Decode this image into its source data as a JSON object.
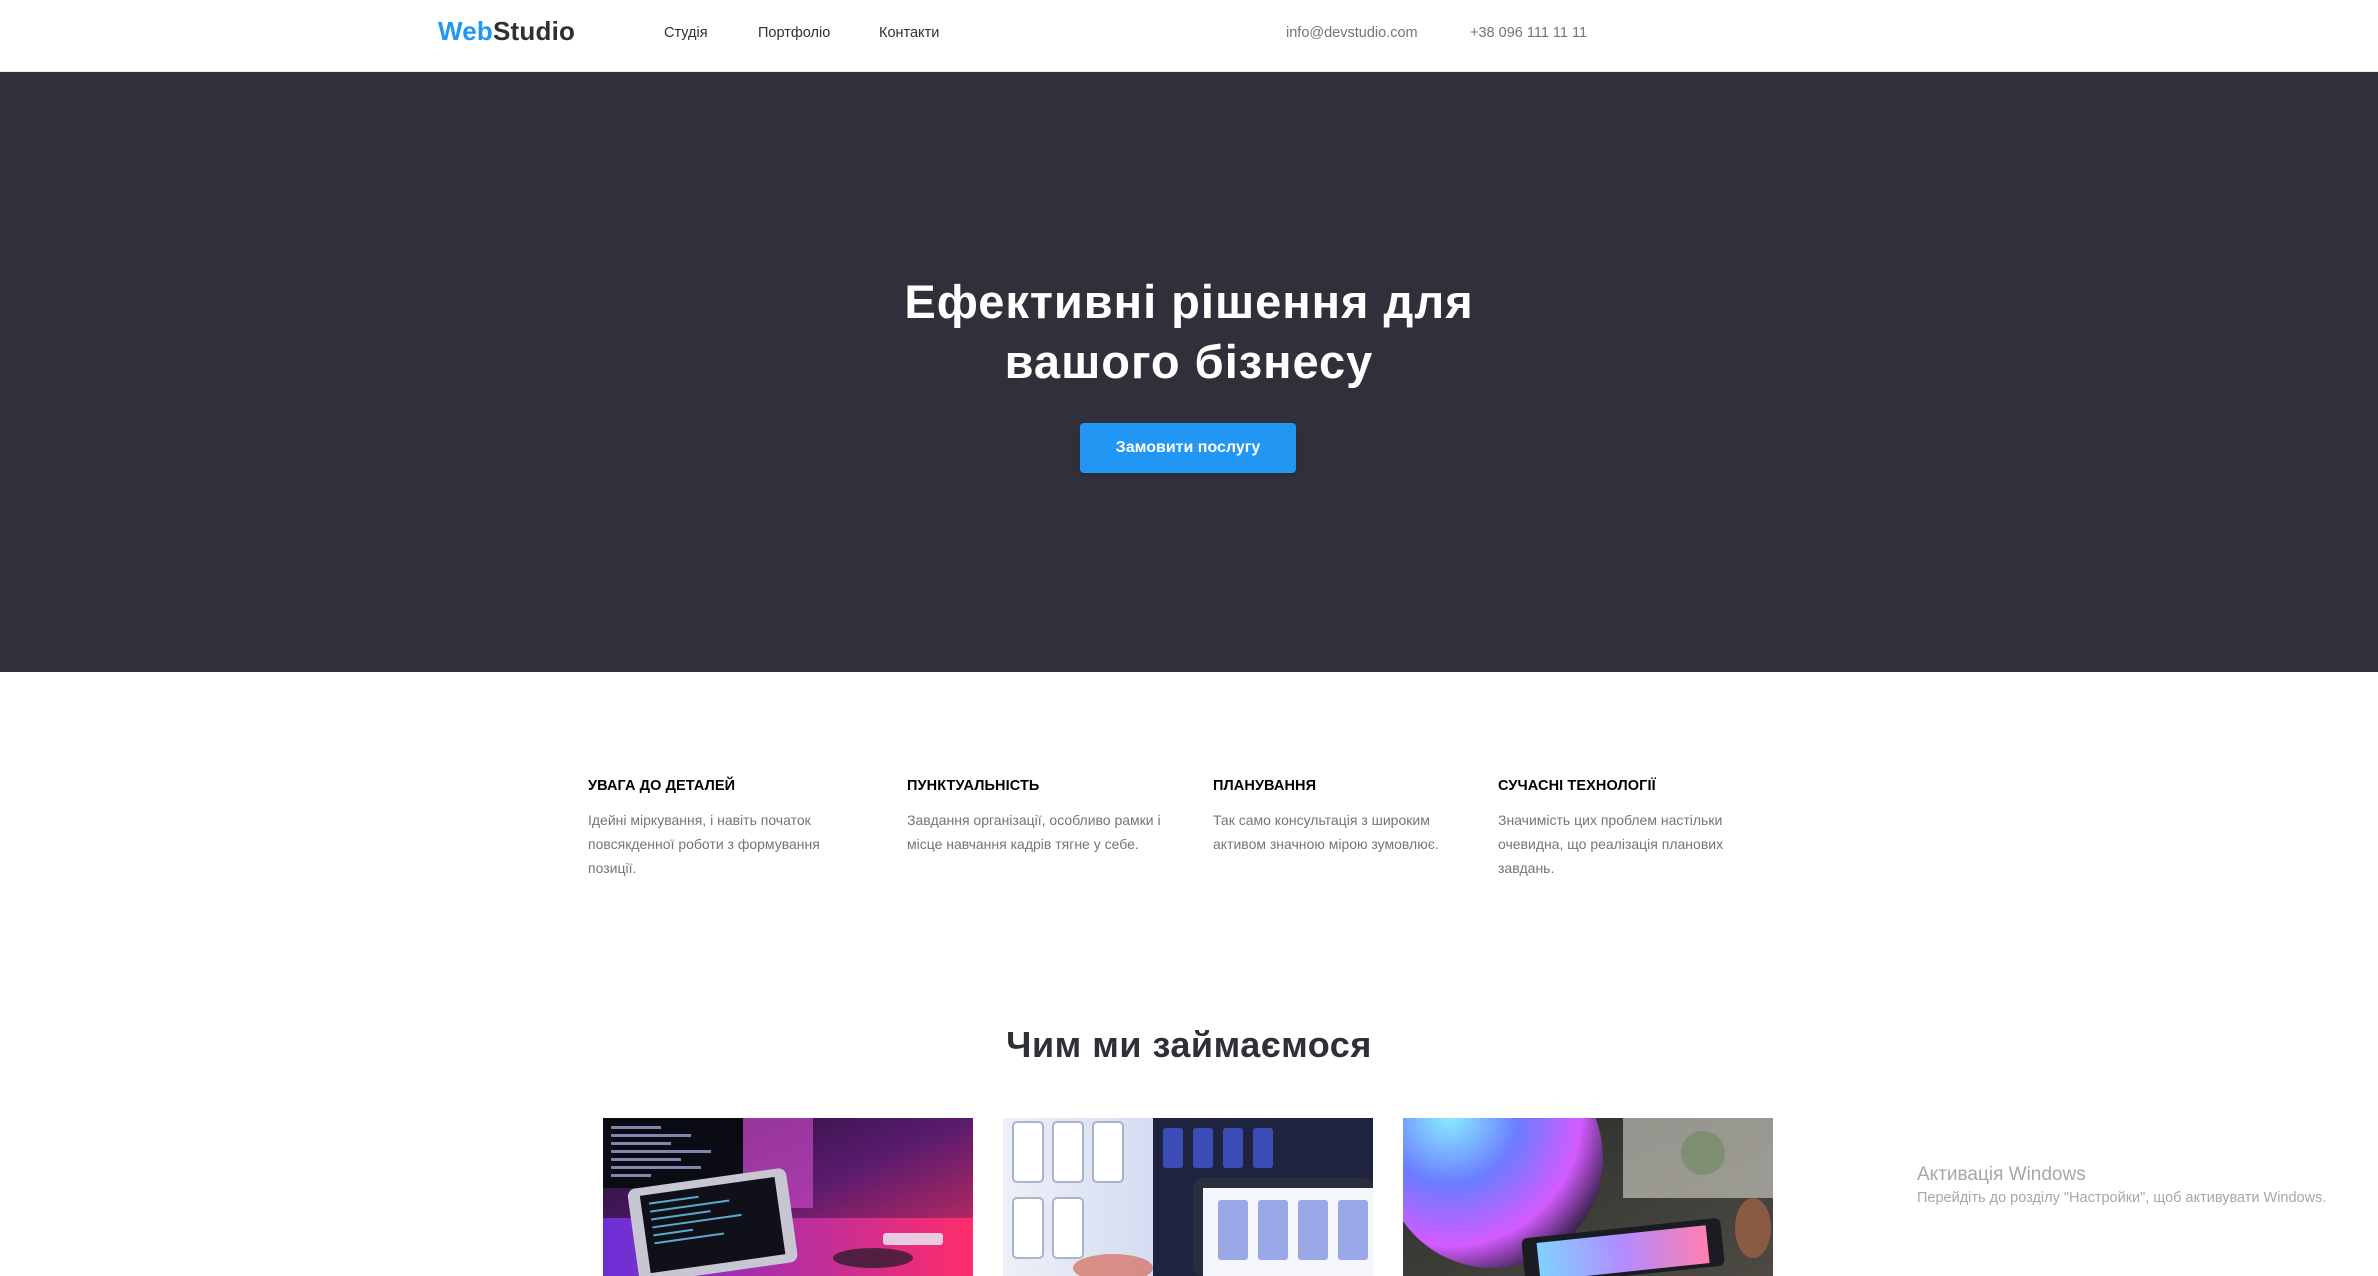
{
  "header": {
    "logo_part1": "Web",
    "logo_part2": "Studio",
    "nav": [
      {
        "label": "Студія"
      },
      {
        "label": "Портфоліо"
      },
      {
        "label": "Контакти"
      }
    ],
    "email": "info@devstudio.com",
    "phone": "+38 096 111 11 11"
  },
  "hero": {
    "title_line1": "Ефективні рішення для",
    "title_line2": "вашого бізнесу",
    "button_label": "Замовити послугу"
  },
  "features": [
    {
      "title": "Увага до деталей",
      "text_lines": [
        "Ідейні міркування, і навіть початок",
        "повсякденної роботи з формування",
        "позиції."
      ]
    },
    {
      "title": "Пунктуальність",
      "text_lines": [
        "Завдання організації, особливо рамки і",
        "місце навчання кадрів тягне у себе."
      ]
    },
    {
      "title": "Планування",
      "text_lines": [
        "Так само консультація з широким",
        "активом значною мірою зумовлює."
      ]
    },
    {
      "title": "Сучасні технології",
      "text_lines": [
        "Значимість цих проблем настільки",
        "очевидна, що реалізація планових",
        "завдань."
      ]
    }
  ],
  "services": {
    "title": "Чим ми займаємося"
  },
  "watermark": {
    "title": "Активація Windows",
    "subtitle": "Перейдіть до розділу \"Настройки\", щоб активувати Windows."
  },
  "colors": {
    "accent": "#2196f3",
    "hero_bg": "#2f303a",
    "text_dark": "#2f2f37",
    "text_muted": "#757575"
  }
}
